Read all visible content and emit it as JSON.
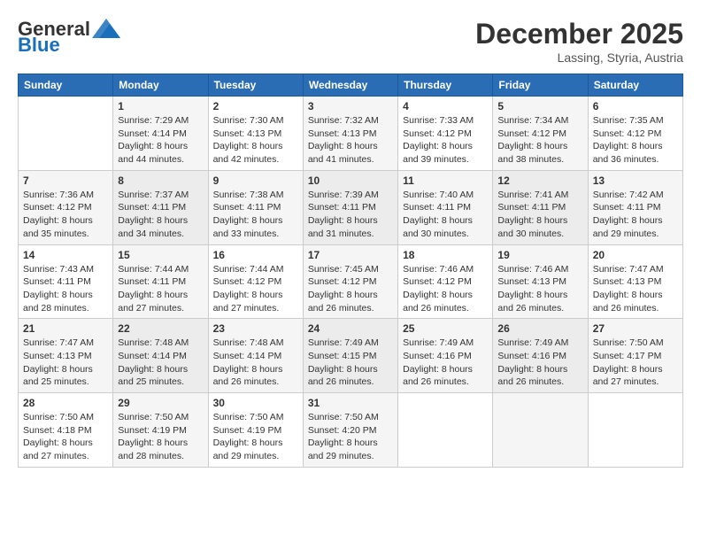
{
  "header": {
    "logo_general": "General",
    "logo_blue": "Blue",
    "month_title": "December 2025",
    "location": "Lassing, Styria, Austria"
  },
  "weekdays": [
    "Sunday",
    "Monday",
    "Tuesday",
    "Wednesday",
    "Thursday",
    "Friday",
    "Saturday"
  ],
  "weeks": [
    [
      {
        "day": "",
        "info": ""
      },
      {
        "day": "1",
        "info": "Sunrise: 7:29 AM\nSunset: 4:14 PM\nDaylight: 8 hours\nand 44 minutes."
      },
      {
        "day": "2",
        "info": "Sunrise: 7:30 AM\nSunset: 4:13 PM\nDaylight: 8 hours\nand 42 minutes."
      },
      {
        "day": "3",
        "info": "Sunrise: 7:32 AM\nSunset: 4:13 PM\nDaylight: 8 hours\nand 41 minutes."
      },
      {
        "day": "4",
        "info": "Sunrise: 7:33 AM\nSunset: 4:12 PM\nDaylight: 8 hours\nand 39 minutes."
      },
      {
        "day": "5",
        "info": "Sunrise: 7:34 AM\nSunset: 4:12 PM\nDaylight: 8 hours\nand 38 minutes."
      },
      {
        "day": "6",
        "info": "Sunrise: 7:35 AM\nSunset: 4:12 PM\nDaylight: 8 hours\nand 36 minutes."
      }
    ],
    [
      {
        "day": "7",
        "info": "Sunrise: 7:36 AM\nSunset: 4:12 PM\nDaylight: 8 hours\nand 35 minutes."
      },
      {
        "day": "8",
        "info": "Sunrise: 7:37 AM\nSunset: 4:11 PM\nDaylight: 8 hours\nand 34 minutes."
      },
      {
        "day": "9",
        "info": "Sunrise: 7:38 AM\nSunset: 4:11 PM\nDaylight: 8 hours\nand 33 minutes."
      },
      {
        "day": "10",
        "info": "Sunrise: 7:39 AM\nSunset: 4:11 PM\nDaylight: 8 hours\nand 31 minutes."
      },
      {
        "day": "11",
        "info": "Sunrise: 7:40 AM\nSunset: 4:11 PM\nDaylight: 8 hours\nand 30 minutes."
      },
      {
        "day": "12",
        "info": "Sunrise: 7:41 AM\nSunset: 4:11 PM\nDaylight: 8 hours\nand 30 minutes."
      },
      {
        "day": "13",
        "info": "Sunrise: 7:42 AM\nSunset: 4:11 PM\nDaylight: 8 hours\nand 29 minutes."
      }
    ],
    [
      {
        "day": "14",
        "info": "Sunrise: 7:43 AM\nSunset: 4:11 PM\nDaylight: 8 hours\nand 28 minutes."
      },
      {
        "day": "15",
        "info": "Sunrise: 7:44 AM\nSunset: 4:11 PM\nDaylight: 8 hours\nand 27 minutes."
      },
      {
        "day": "16",
        "info": "Sunrise: 7:44 AM\nSunset: 4:12 PM\nDaylight: 8 hours\nand 27 minutes."
      },
      {
        "day": "17",
        "info": "Sunrise: 7:45 AM\nSunset: 4:12 PM\nDaylight: 8 hours\nand 26 minutes."
      },
      {
        "day": "18",
        "info": "Sunrise: 7:46 AM\nSunset: 4:12 PM\nDaylight: 8 hours\nand 26 minutes."
      },
      {
        "day": "19",
        "info": "Sunrise: 7:46 AM\nSunset: 4:13 PM\nDaylight: 8 hours\nand 26 minutes."
      },
      {
        "day": "20",
        "info": "Sunrise: 7:47 AM\nSunset: 4:13 PM\nDaylight: 8 hours\nand 26 minutes."
      }
    ],
    [
      {
        "day": "21",
        "info": "Sunrise: 7:47 AM\nSunset: 4:13 PM\nDaylight: 8 hours\nand 25 minutes."
      },
      {
        "day": "22",
        "info": "Sunrise: 7:48 AM\nSunset: 4:14 PM\nDaylight: 8 hours\nand 25 minutes."
      },
      {
        "day": "23",
        "info": "Sunrise: 7:48 AM\nSunset: 4:14 PM\nDaylight: 8 hours\nand 26 minutes."
      },
      {
        "day": "24",
        "info": "Sunrise: 7:49 AM\nSunset: 4:15 PM\nDaylight: 8 hours\nand 26 minutes."
      },
      {
        "day": "25",
        "info": "Sunrise: 7:49 AM\nSunset: 4:16 PM\nDaylight: 8 hours\nand 26 minutes."
      },
      {
        "day": "26",
        "info": "Sunrise: 7:49 AM\nSunset: 4:16 PM\nDaylight: 8 hours\nand 26 minutes."
      },
      {
        "day": "27",
        "info": "Sunrise: 7:50 AM\nSunset: 4:17 PM\nDaylight: 8 hours\nand 27 minutes."
      }
    ],
    [
      {
        "day": "28",
        "info": "Sunrise: 7:50 AM\nSunset: 4:18 PM\nDaylight: 8 hours\nand 27 minutes."
      },
      {
        "day": "29",
        "info": "Sunrise: 7:50 AM\nSunset: 4:19 PM\nDaylight: 8 hours\nand 28 minutes."
      },
      {
        "day": "30",
        "info": "Sunrise: 7:50 AM\nSunset: 4:19 PM\nDaylight: 8 hours\nand 29 minutes."
      },
      {
        "day": "31",
        "info": "Sunrise: 7:50 AM\nSunset: 4:20 PM\nDaylight: 8 hours\nand 29 minutes."
      },
      {
        "day": "",
        "info": ""
      },
      {
        "day": "",
        "info": ""
      },
      {
        "day": "",
        "info": ""
      }
    ]
  ]
}
